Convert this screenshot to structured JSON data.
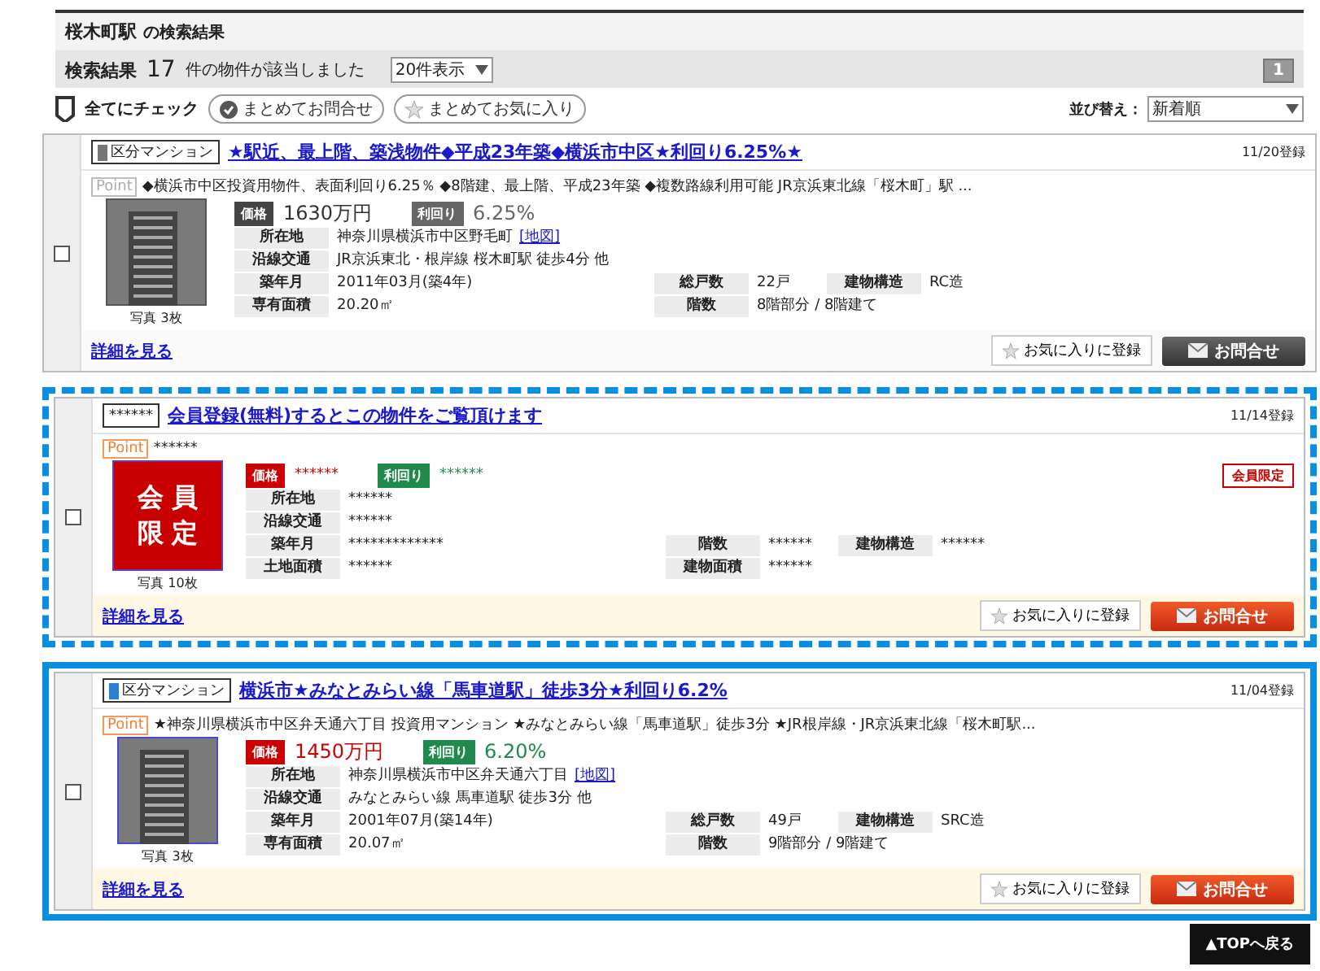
{
  "header": {
    "station": "桜木町駅",
    "suffix": "の検索結果"
  },
  "results": {
    "label": "検索結果",
    "count": "17",
    "suffix": "件の物件が該当しました",
    "per_page": "20件表示",
    "page": "1"
  },
  "toolbar": {
    "check_all": "全てにチェック",
    "bulk_inquiry": "まとめてお問合せ",
    "bulk_favorite": "まとめてお気に入り",
    "sort_label": "並び替え：",
    "sort_value": "新着順"
  },
  "listings": [
    {
      "kind": "normal",
      "muted": true,
      "selected": false,
      "focused": false,
      "checked": false,
      "type_label": "区分マンション",
      "title": "★駅近、最上階、築浅物件◆平成23年築◆横浜市中区★利回り6.25%★",
      "date": "11/20登録",
      "point_label": "Point",
      "point": "◆横浜市中区投資用物件、表面利回り6.25％ ◆8階建、最上階、平成23年築 ◆複数路線利用可能 JR京浜東北線「桜木町」駅 ...",
      "photo_caption": "写真 3枚",
      "price_label": "価格",
      "price": "1630万円",
      "yield_label": "利回り",
      "yield": "6.25%",
      "rows": [
        [
          {
            "label": "所在地",
            "value": "神奈川県横浜市中区野毛町",
            "link": "[地図]"
          }
        ],
        [
          {
            "label": "沿線交通",
            "value": "JR京浜東北・根岸線 桜木町駅 徒歩4分 他"
          }
        ],
        [
          {
            "label": "築年月",
            "value": "2011年03月(築4年)"
          },
          {
            "label": "総戸数",
            "value": "22戸"
          },
          {
            "label": "建物構造",
            "value": "RC造"
          }
        ],
        [
          {
            "label": "専有面積",
            "value": "20.20㎡"
          },
          {
            "label": "階数",
            "value": "8階部分 / 8階建て"
          }
        ]
      ],
      "detail_link": "詳細を見る",
      "favorite": "お気に入りに登録",
      "inquiry": "お問合せ"
    },
    {
      "kind": "member_only",
      "muted": false,
      "selected": true,
      "focused": false,
      "checked": false,
      "type_label": "******",
      "title": "会員登録(無料)するとこの物件をご覧頂けます",
      "date": "11/14登録",
      "point_label": "Point",
      "point": "******",
      "photo_text": "会員限定",
      "photo_caption": "写真 10枚",
      "price_label": "価格",
      "price": "******",
      "yield_label": "利回り",
      "yield": "******",
      "badge": "会員限定",
      "rows": [
        [
          {
            "label": "所在地",
            "value": "******"
          }
        ],
        [
          {
            "label": "沿線交通",
            "value": "******"
          }
        ],
        [
          {
            "label": "築年月",
            "value": "*************"
          },
          {
            "label": "階数",
            "value": "******"
          },
          {
            "label": "建物構造",
            "value": "******"
          }
        ],
        [
          {
            "label": "土地面積",
            "value": "******"
          },
          {
            "label": "建物面積",
            "value": "******"
          }
        ]
      ],
      "detail_link": "詳細を見る",
      "favorite": "お気に入りに登録",
      "inquiry": "お問合せ"
    },
    {
      "kind": "normal",
      "muted": false,
      "selected": true,
      "focused": true,
      "checked": false,
      "type_label": "区分マンション",
      "title": "横浜市★みなとみらい線「馬車道駅」徒歩3分★利回り6.2%",
      "date": "11/04登録",
      "point_label": "Point",
      "point": "★神奈川県横浜市中区弁天通六丁目 投資用マンション ★みなとみらい線「馬車道駅」徒歩3分 ★JR根岸線・JR京浜東北線「桜木町駅...",
      "photo_caption": "写真 3枚",
      "price_label": "価格",
      "price": "1450万円",
      "yield_label": "利回り",
      "yield": "6.20%",
      "rows": [
        [
          {
            "label": "所在地",
            "value": "神奈川県横浜市中区弁天通六丁目",
            "link": "[地図]"
          }
        ],
        [
          {
            "label": "沿線交通",
            "value": "みなとみらい線 馬車道駅 徒歩3分 他"
          }
        ],
        [
          {
            "label": "築年月",
            "value": "2001年07月(築14年)"
          },
          {
            "label": "総戸数",
            "value": "49戸"
          },
          {
            "label": "建物構造",
            "value": "SRC造"
          }
        ],
        [
          {
            "label": "専有面積",
            "value": "20.07㎡"
          },
          {
            "label": "階数",
            "value": "9階部分 / 9階建て"
          }
        ]
      ],
      "detail_link": "詳細を見る",
      "favorite": "お気に入りに登録",
      "inquiry": "お問合せ"
    }
  ],
  "back_to_top": "▲TOPへ戻る"
}
